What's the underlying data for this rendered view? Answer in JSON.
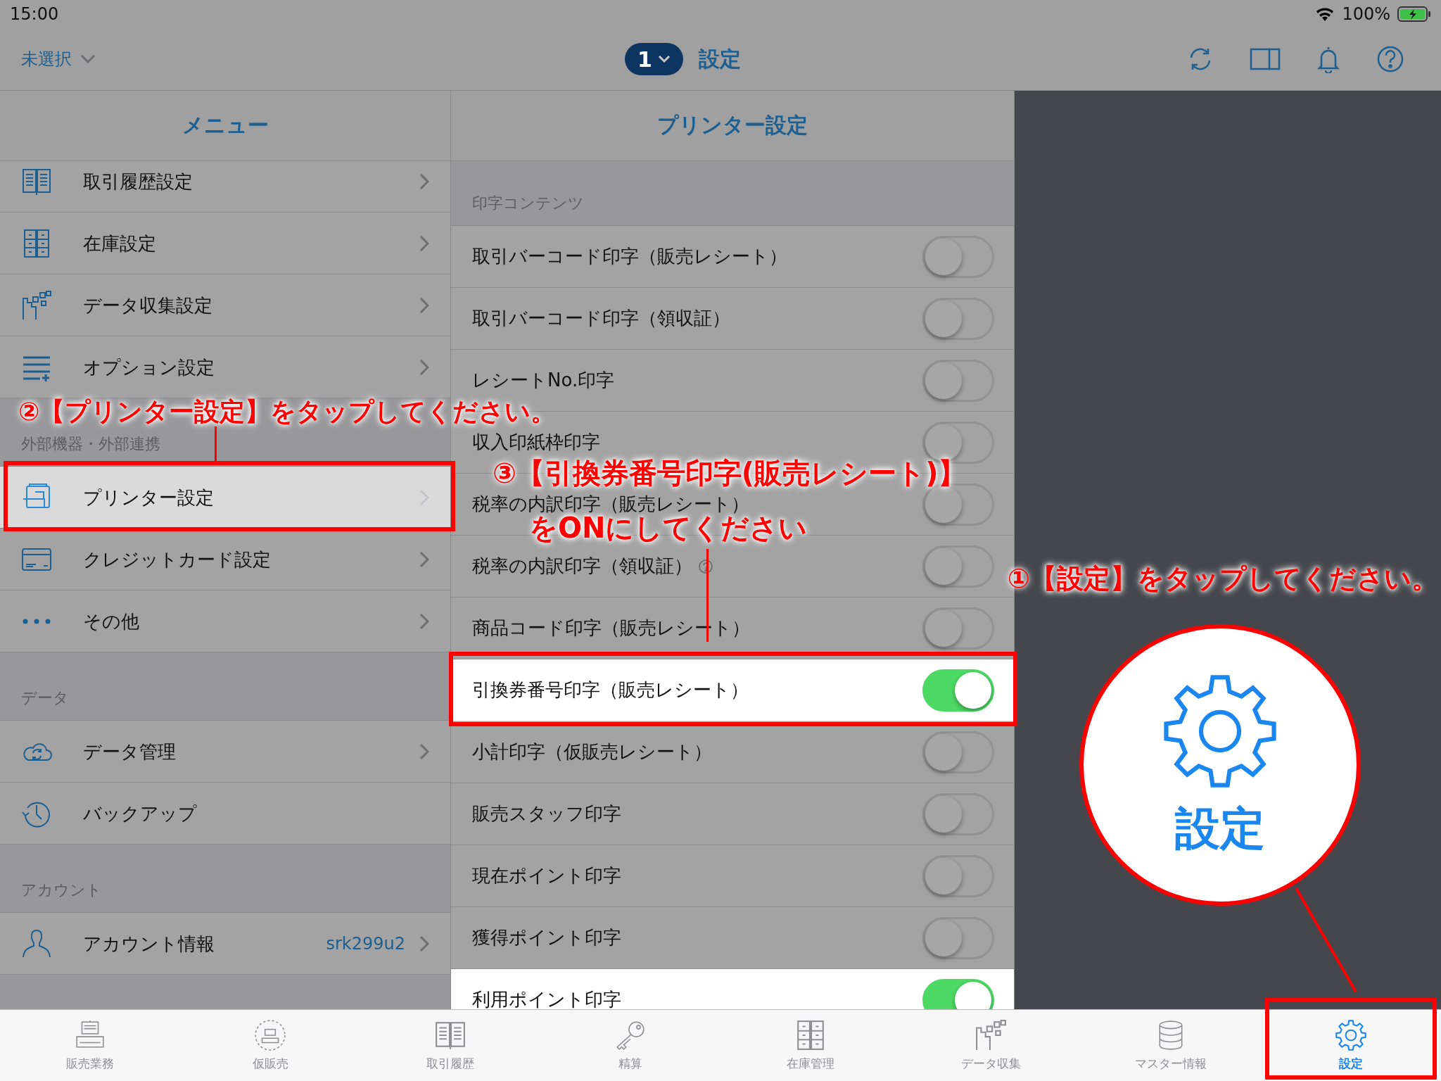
{
  "status_bar": {
    "time": "15:00",
    "battery": "100%"
  },
  "nav": {
    "store": "未選択",
    "register": "1",
    "title": "設定"
  },
  "menu": {
    "title": "メニュー",
    "sections": [
      {
        "items": [
          {
            "label": "取引履歴設定",
            "disclosure": true,
            "highlighted": false
          },
          {
            "label": "在庫設定",
            "disclosure": true,
            "highlighted": false
          },
          {
            "label": "データ収集設定",
            "disclosure": true,
            "highlighted": false
          },
          {
            "label": "オプション設定",
            "disclosure": true,
            "highlighted": false
          }
        ]
      },
      {
        "header": "外部機器・外部連携",
        "items": [
          {
            "label": "プリンター設定",
            "disclosure": true,
            "highlighted": true
          },
          {
            "label": "クレジットカード設定",
            "disclosure": true,
            "highlighted": false
          },
          {
            "label": "その他",
            "disclosure": true,
            "highlighted": false
          }
        ]
      },
      {
        "header": "データ",
        "items": [
          {
            "label": "データ管理",
            "disclosure": true,
            "highlighted": false
          },
          {
            "label": "バックアップ",
            "disclosure": false,
            "highlighted": false
          }
        ]
      },
      {
        "header": "アカウント",
        "items": [
          {
            "label": "アカウント情報",
            "value": "srk299u2",
            "disclosure": true,
            "highlighted": false
          }
        ]
      }
    ]
  },
  "printer": {
    "title": "プリンター設定",
    "section": "印字コンテンツ",
    "items": [
      {
        "label": "取引バーコード印字（販売レシート）",
        "on": false,
        "help_icon": false,
        "highlighted": false
      },
      {
        "label": "取引バーコード印字（領収証）",
        "on": false,
        "help_icon": false,
        "highlighted": false
      },
      {
        "label": "レシートNo.印字",
        "on": false,
        "help_icon": false,
        "highlighted": false
      },
      {
        "label": "収入印紙枠印字",
        "on": false,
        "help_icon": false,
        "highlighted": false
      },
      {
        "label": "税率の内訳印字（販売レシート）",
        "on": false,
        "help_icon": false,
        "highlighted": false
      },
      {
        "label": "税率の内訳印字（領収証）",
        "on": false,
        "help_icon": true,
        "highlighted": false
      },
      {
        "label": "商品コード印字（販売レシート）",
        "on": false,
        "help_icon": false,
        "highlighted": false
      },
      {
        "label": "引換券番号印字（販売レシート）",
        "on": true,
        "help_icon": false,
        "highlighted": true
      },
      {
        "label": "小計印字（仮販売レシート）",
        "on": false,
        "help_icon": false,
        "highlighted": false
      },
      {
        "label": "販売スタッフ印字",
        "on": false,
        "help_icon": false,
        "highlighted": false
      },
      {
        "label": "現在ポイント印字",
        "on": false,
        "help_icon": false,
        "highlighted": false
      },
      {
        "label": "獲得ポイント印字",
        "on": false,
        "help_icon": false,
        "highlighted": false
      },
      {
        "label": "利用ポイント印字",
        "on": true,
        "help_icon": false,
        "highlighted": true
      }
    ]
  },
  "tabs": [
    {
      "label": "販売業務",
      "selected": false
    },
    {
      "label": "仮販売",
      "selected": false
    },
    {
      "label": "取引履歴",
      "selected": false
    },
    {
      "label": "精算",
      "selected": false
    },
    {
      "label": "在庫管理",
      "selected": false
    },
    {
      "label": "データ収集",
      "selected": false
    },
    {
      "label": "マスター情報",
      "selected": false
    },
    {
      "label": "設定",
      "selected": true
    }
  ],
  "annotations": {
    "step_2": "②【プリンター設定】をタップしてください。",
    "step_3": [
      "③【引換券番号印字(販売レシート)】",
      "をONにしてください"
    ],
    "step_1": "①【設定】をタップしてください。",
    "magnifier_label": "設定"
  }
}
